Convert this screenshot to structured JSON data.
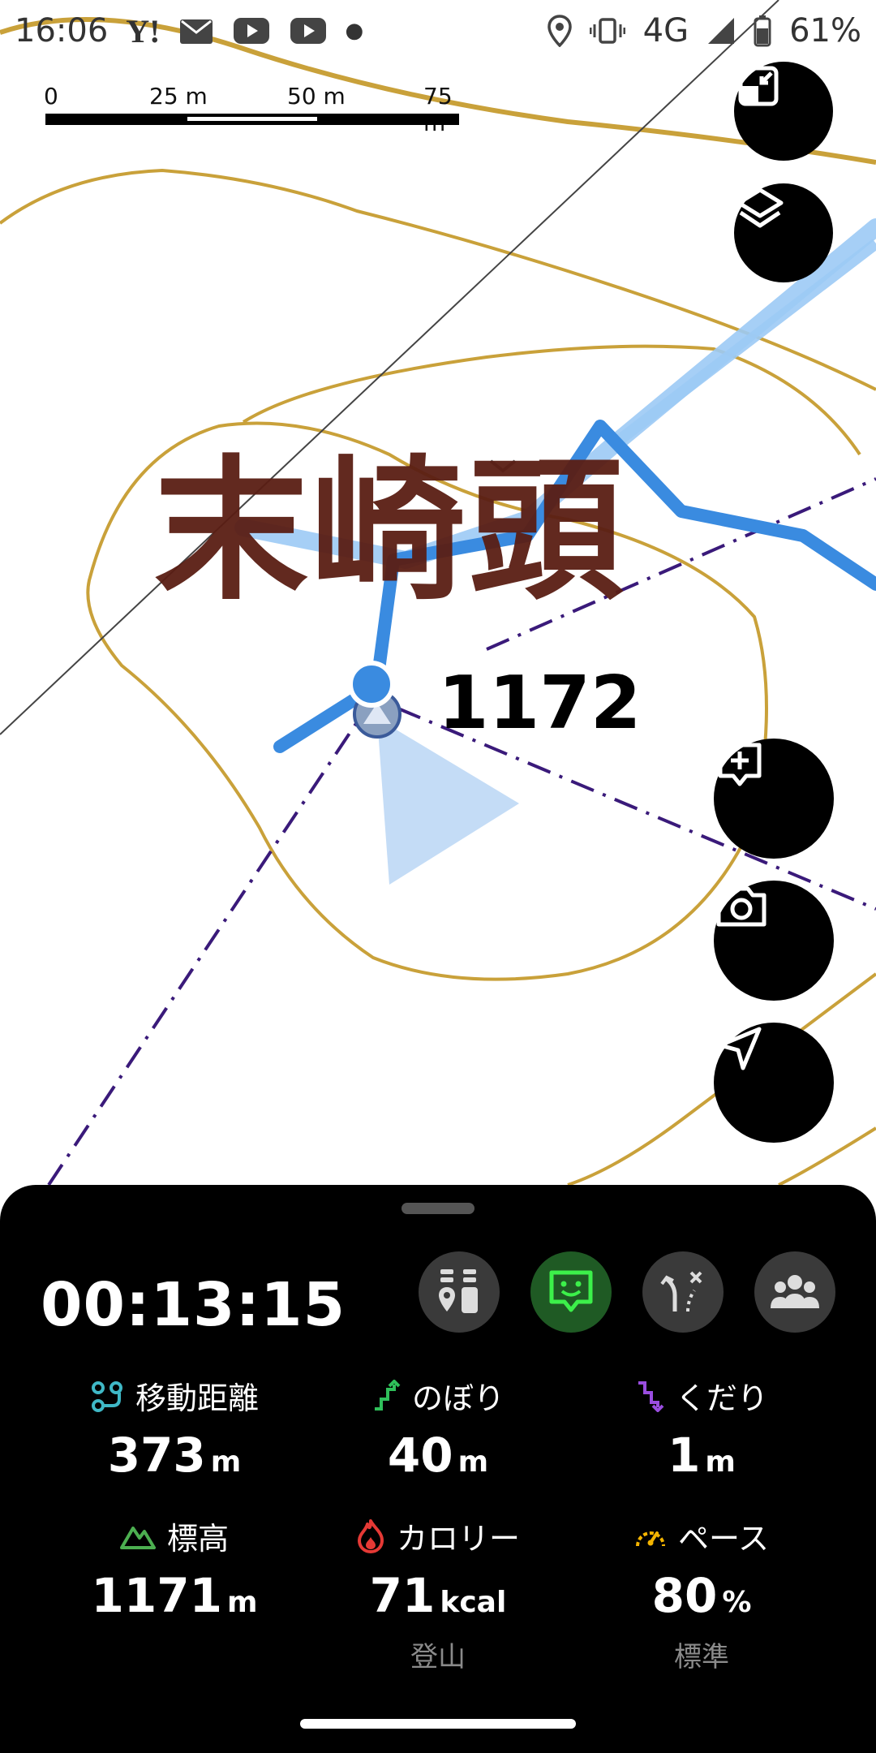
{
  "status_bar": {
    "time": "16:06",
    "notification_icons": [
      "yahoo-icon",
      "mail-icon",
      "youtube-icon",
      "youtube-icon",
      "dot-icon"
    ],
    "network": "4G",
    "battery": "61%"
  },
  "map": {
    "scale": {
      "labels": [
        "0",
        "25 m",
        "50 m",
        "75 m"
      ]
    },
    "peak_name": "末崎頭",
    "peak_elevation": "1172",
    "colors": {
      "contour": "#c9a13a",
      "track_past": "#3a8be0",
      "track_planned": "#9ccaf5",
      "trail": "#3a1a7a"
    },
    "buttons": [
      "fullscreen-exit-icon",
      "layers-icon",
      "add-note-icon",
      "camera-icon",
      "navigate-icon"
    ]
  },
  "panel": {
    "elapsed_time": "00:13:15",
    "modes": [
      {
        "icon": "checkpoint-icon",
        "active": false
      },
      {
        "icon": "assistant-icon",
        "active": true
      },
      {
        "icon": "off-route-icon",
        "active": false
      },
      {
        "icon": "group-icon",
        "active": false
      }
    ],
    "stats": {
      "distance": {
        "label": "移動距離",
        "value": "373",
        "unit": "m",
        "color": "#3fb8c6"
      },
      "ascent": {
        "label": "のぼり",
        "value": "40",
        "unit": "m",
        "color": "#2fbf5a"
      },
      "descent": {
        "label": "くだり",
        "value": "1",
        "unit": "m",
        "color": "#9a4de0"
      },
      "elevation": {
        "label": "標高",
        "value": "1171",
        "unit": "m",
        "color": "#4caf50"
      },
      "calories": {
        "label": "カロリー",
        "value": "71",
        "unit": "kcal",
        "sub": "登山",
        "color": "#e53935"
      },
      "pace": {
        "label": "ペース",
        "value": "80",
        "unit": "%",
        "sub": "標準",
        "color": "#f4b400"
      }
    }
  }
}
